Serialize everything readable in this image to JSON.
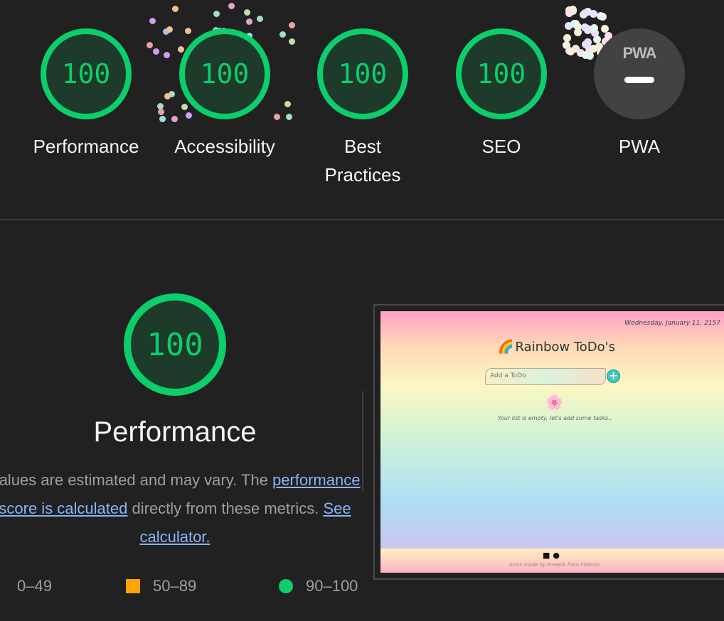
{
  "categories": [
    {
      "label": "Performance",
      "score": "100"
    },
    {
      "label": "Accessibility",
      "score": "100"
    },
    {
      "label": "Best Practices",
      "score": "100"
    },
    {
      "label": "SEO",
      "score": "100"
    },
    {
      "label": "PWA",
      "badge": "PWA"
    }
  ],
  "performance": {
    "score": "100",
    "title": "Performance",
    "desc_1": "Values are estimated and may vary. The ",
    "link_1": "performance score is calculated",
    "desc_2": " directly from these metrics. ",
    "link_2": "See calculator."
  },
  "legend": [
    "0–49",
    "50–89",
    "90–100"
  ],
  "colors": {
    "pass": "#0cce6b",
    "average": "#ffa400",
    "background": "#212121"
  },
  "screenshot": {
    "date": "Wednesday, January 11, 2157",
    "title": "Rainbow ToDo's",
    "placeholder": "Add a ToDo",
    "empty": "Your list is empty, let's add some tasks..",
    "credit": "Icons made by Freepik from Flaticon"
  }
}
